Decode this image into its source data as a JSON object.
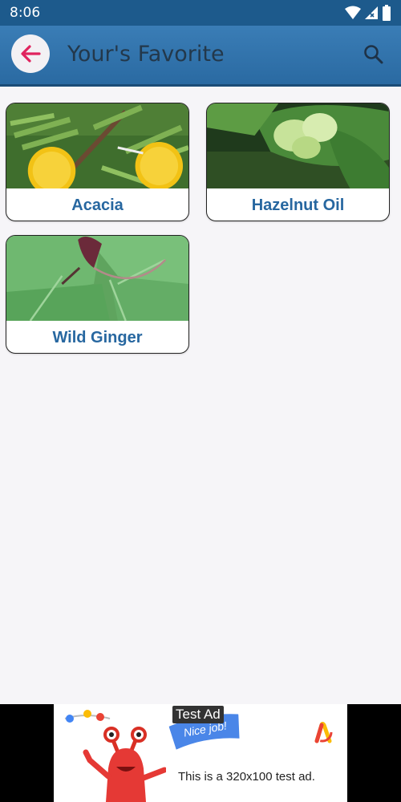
{
  "status_bar": {
    "time": "8:06"
  },
  "header": {
    "title": "Your's Favorite"
  },
  "favorites": [
    {
      "name": "Acacia"
    },
    {
      "name": "Hazelnut Oil"
    },
    {
      "name": "Wild Ginger"
    }
  ],
  "ad": {
    "tag": "Test Ad",
    "flag_text": "Nice job!",
    "text": "This is a 320x100 test ad."
  },
  "colors": {
    "app_bar": "#2f73ab",
    "status_bar": "#1d5a8c",
    "label_blue": "#2767a0",
    "back_arrow": "#e0245e",
    "background": "#f6f5f8"
  }
}
